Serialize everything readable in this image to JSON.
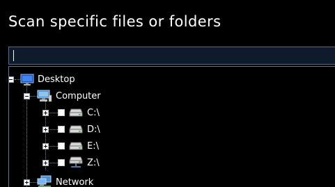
{
  "header": {
    "title": "Scan specific files or folders"
  },
  "path_input": {
    "value": ""
  },
  "tree": {
    "desktop": {
      "label": "Desktop",
      "icon": "desktop-icon",
      "expanded": true
    },
    "computer": {
      "label": "Computer",
      "icon": "computer-icon",
      "expanded": true
    },
    "drives": [
      {
        "label": "C:\\",
        "icon": "hard-drive-icon",
        "checked": false,
        "expanded": false
      },
      {
        "label": "D:\\",
        "icon": "hard-drive-icon",
        "checked": false,
        "expanded": false
      },
      {
        "label": "E:\\",
        "icon": "hard-drive-icon",
        "checked": false,
        "expanded": false
      },
      {
        "label": "Z:\\",
        "icon": "network-drive-icon",
        "checked": false,
        "expanded": false
      }
    ],
    "network": {
      "label": "Network",
      "icon": "network-icon",
      "expanded": false
    }
  },
  "colors": {
    "background": "#000000",
    "input_background": "#0f1a2a",
    "input_border": "#5a6a80",
    "text": "#ffffff"
  }
}
